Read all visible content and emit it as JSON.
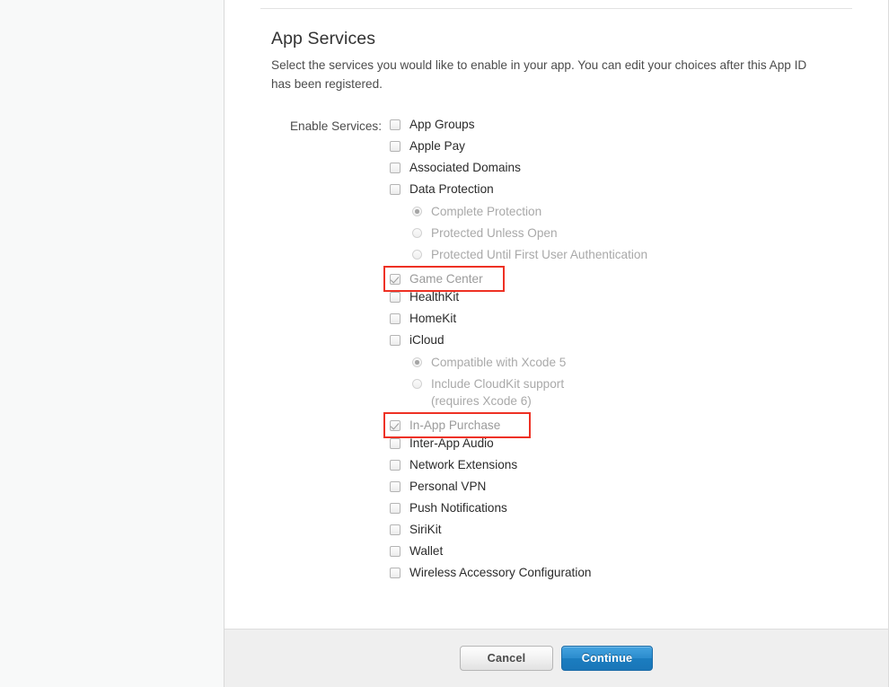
{
  "window": {
    "title": "App Services"
  },
  "section": {
    "title": "App Services",
    "description": "Select the services you would like to enable in your app. You can edit your choices after this App ID has been registered."
  },
  "form": {
    "field_label": "Enable Services:"
  },
  "services": [
    {
      "label": "App Groups",
      "checked": false,
      "highlighted": false,
      "dim": false
    },
    {
      "label": "Apple Pay",
      "checked": false,
      "highlighted": false,
      "dim": false
    },
    {
      "label": "Associated Domains",
      "checked": false,
      "highlighted": false,
      "dim": false
    },
    {
      "label": "Data Protection",
      "checked": false,
      "highlighted": false,
      "dim": false
    },
    {
      "label": "Game Center",
      "checked": true,
      "highlighted": true,
      "dim": true
    },
    {
      "label": "HealthKit",
      "checked": false,
      "highlighted": false,
      "dim": false
    },
    {
      "label": "HomeKit",
      "checked": false,
      "highlighted": false,
      "dim": false
    },
    {
      "label": "iCloud",
      "checked": false,
      "highlighted": false,
      "dim": false
    },
    {
      "label": "In-App Purchase",
      "checked": true,
      "highlighted": true,
      "dim": true
    },
    {
      "label": "Inter-App Audio",
      "checked": false,
      "highlighted": false,
      "dim": false
    },
    {
      "label": "Network Extensions",
      "checked": false,
      "highlighted": false,
      "dim": false
    },
    {
      "label": "Personal VPN",
      "checked": false,
      "highlighted": false,
      "dim": false
    },
    {
      "label": "Push Notifications",
      "checked": false,
      "highlighted": false,
      "dim": false
    },
    {
      "label": "SiriKit",
      "checked": false,
      "highlighted": false,
      "dim": false
    },
    {
      "label": "Wallet",
      "checked": false,
      "highlighted": false,
      "dim": false
    },
    {
      "label": "Wireless Accessory Configuration",
      "checked": false,
      "highlighted": false,
      "dim": false
    }
  ],
  "data_protection_options": [
    {
      "label": "Complete Protection",
      "selected": true
    },
    {
      "label": "Protected Unless Open",
      "selected": false
    },
    {
      "label": "Protected Until First User Authentication",
      "selected": false
    }
  ],
  "icloud_options": [
    {
      "label": "Compatible with Xcode 5",
      "selected": true
    },
    {
      "label": "Include CloudKit support\n(requires Xcode 6)",
      "selected": false
    }
  ],
  "footer": {
    "cancel_label": "Cancel",
    "continue_label": "Continue"
  },
  "colors": {
    "highlight_border": "#ee3124",
    "primary_button": "#1b7dc0",
    "footer_background": "#efefef",
    "sidebar_background": "#f8f9f9",
    "text": "#2b2b2b",
    "dim_text": "#9b9b9b"
  }
}
